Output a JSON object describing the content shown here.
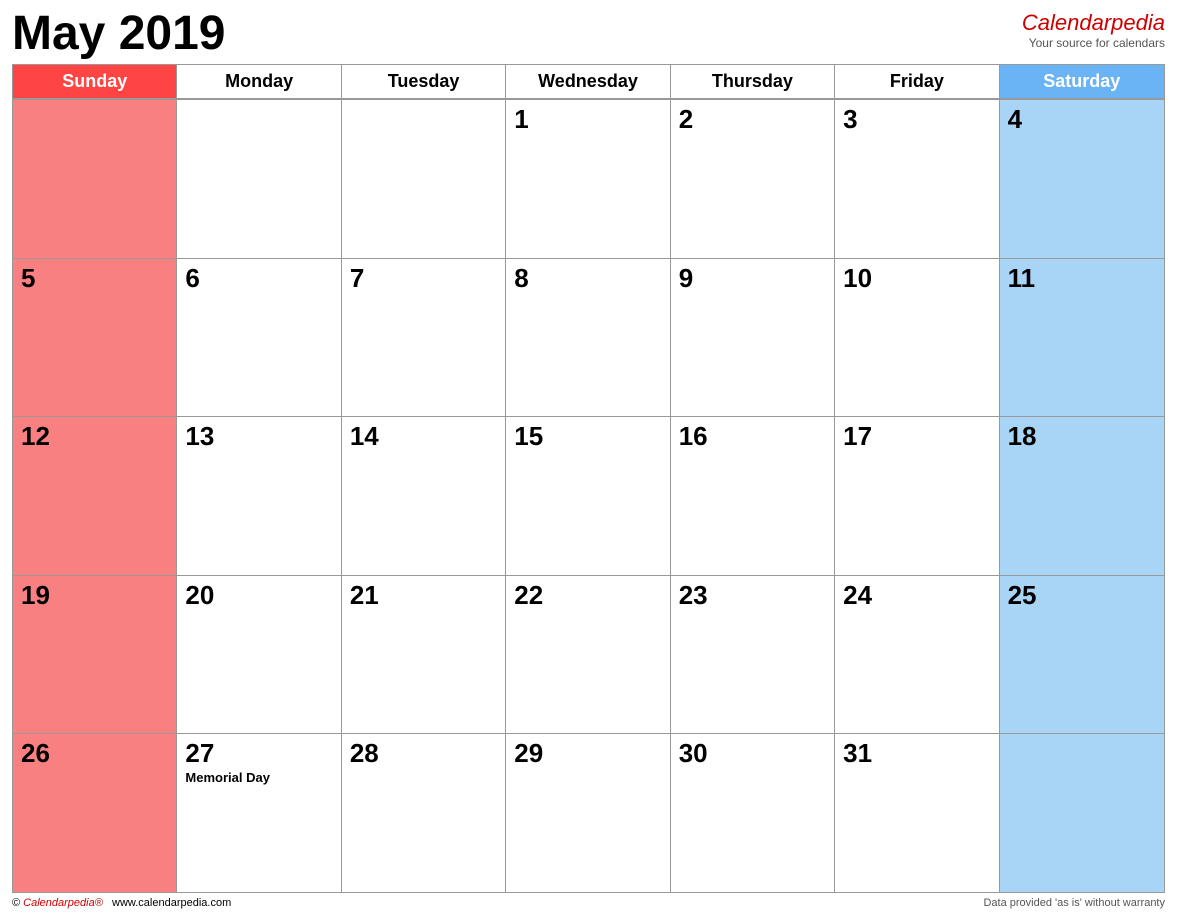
{
  "header": {
    "title": "May 2019",
    "brand_name": "Calendar",
    "brand_italic": "pedia",
    "brand_tagline": "Your source for calendars"
  },
  "day_headers": [
    {
      "label": "Sunday",
      "type": "sunday"
    },
    {
      "label": "Monday",
      "type": "weekday"
    },
    {
      "label": "Tuesday",
      "type": "weekday"
    },
    {
      "label": "Wednesday",
      "type": "weekday"
    },
    {
      "label": "Thursday",
      "type": "weekday"
    },
    {
      "label": "Friday",
      "type": "weekday"
    },
    {
      "label": "Saturday",
      "type": "saturday"
    }
  ],
  "rows": [
    {
      "cells": [
        {
          "number": "",
          "type": "sunday",
          "holiday": ""
        },
        {
          "number": "",
          "type": "normal",
          "holiday": ""
        },
        {
          "number": "",
          "type": "normal",
          "holiday": ""
        },
        {
          "number": "1",
          "type": "normal",
          "holiday": ""
        },
        {
          "number": "2",
          "type": "normal",
          "holiday": ""
        },
        {
          "number": "3",
          "type": "normal",
          "holiday": ""
        },
        {
          "number": "4",
          "type": "saturday",
          "holiday": ""
        }
      ]
    },
    {
      "cells": [
        {
          "number": "5",
          "type": "sunday",
          "holiday": ""
        },
        {
          "number": "6",
          "type": "normal",
          "holiday": ""
        },
        {
          "number": "7",
          "type": "normal",
          "holiday": ""
        },
        {
          "number": "8",
          "type": "normal",
          "holiday": ""
        },
        {
          "number": "9",
          "type": "normal",
          "holiday": ""
        },
        {
          "number": "10",
          "type": "normal",
          "holiday": ""
        },
        {
          "number": "11",
          "type": "saturday",
          "holiday": ""
        }
      ]
    },
    {
      "cells": [
        {
          "number": "12",
          "type": "sunday",
          "holiday": ""
        },
        {
          "number": "13",
          "type": "normal",
          "holiday": ""
        },
        {
          "number": "14",
          "type": "normal",
          "holiday": ""
        },
        {
          "number": "15",
          "type": "normal",
          "holiday": ""
        },
        {
          "number": "16",
          "type": "normal",
          "holiday": ""
        },
        {
          "number": "17",
          "type": "normal",
          "holiday": ""
        },
        {
          "number": "18",
          "type": "saturday",
          "holiday": ""
        }
      ]
    },
    {
      "cells": [
        {
          "number": "19",
          "type": "sunday",
          "holiday": ""
        },
        {
          "number": "20",
          "type": "normal",
          "holiday": ""
        },
        {
          "number": "21",
          "type": "normal",
          "holiday": ""
        },
        {
          "number": "22",
          "type": "normal",
          "holiday": ""
        },
        {
          "number": "23",
          "type": "normal",
          "holiday": ""
        },
        {
          "number": "24",
          "type": "normal",
          "holiday": ""
        },
        {
          "number": "25",
          "type": "saturday",
          "holiday": ""
        }
      ]
    },
    {
      "cells": [
        {
          "number": "26",
          "type": "sunday",
          "holiday": ""
        },
        {
          "number": "27",
          "type": "normal",
          "holiday": "Memorial Day"
        },
        {
          "number": "28",
          "type": "normal",
          "holiday": ""
        },
        {
          "number": "29",
          "type": "normal",
          "holiday": ""
        },
        {
          "number": "30",
          "type": "normal",
          "holiday": ""
        },
        {
          "number": "31",
          "type": "normal",
          "holiday": ""
        },
        {
          "number": "",
          "type": "saturday",
          "holiday": ""
        }
      ]
    }
  ],
  "footer": {
    "copyright": "© Calendarpedia®   www.calendarpedia.com",
    "disclaimer": "Data provided 'as is' without warranty"
  }
}
